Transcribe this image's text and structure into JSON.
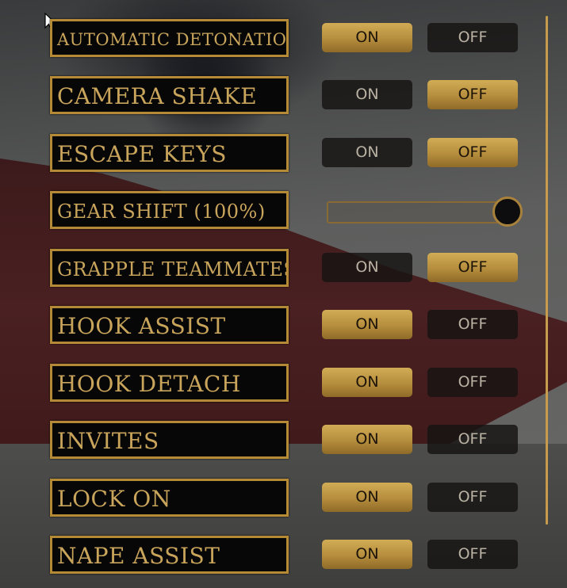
{
  "settings": [
    {
      "label": "AUTOMATIC DETONATION",
      "type": "toggle",
      "on_label": "ON",
      "off_label": "OFF",
      "value": "ON"
    },
    {
      "label": "CAMERA SHAKE",
      "type": "toggle",
      "on_label": "ON",
      "off_label": "OFF",
      "value": "OFF"
    },
    {
      "label": "ESCAPE KEYS",
      "type": "toggle",
      "on_label": "ON",
      "off_label": "OFF",
      "value": "OFF"
    },
    {
      "label": "GEAR SHIFT (100%)",
      "type": "slider",
      "value_percent": 100
    },
    {
      "label": "GRAPPLE TEAMMATES",
      "type": "toggle",
      "on_label": "ON",
      "off_label": "OFF",
      "value": "OFF"
    },
    {
      "label": "HOOK ASSIST",
      "type": "toggle",
      "on_label": "ON",
      "off_label": "OFF",
      "value": "ON"
    },
    {
      "label": "HOOK DETACH",
      "type": "toggle",
      "on_label": "ON",
      "off_label": "OFF",
      "value": "ON"
    },
    {
      "label": "INVITES",
      "type": "toggle",
      "on_label": "ON",
      "off_label": "OFF",
      "value": "ON"
    },
    {
      "label": "LOCK ON",
      "type": "toggle",
      "on_label": "ON",
      "off_label": "OFF",
      "value": "ON"
    },
    {
      "label": "NAPE ASSIST",
      "type": "toggle",
      "on_label": "ON",
      "off_label": "OFF",
      "value": "ON"
    }
  ],
  "colors": {
    "accent_gold": "#c9a55c",
    "label_border": "#b58a37",
    "active_button": "#c29a47",
    "inactive_button": "#161412"
  },
  "icons": {
    "cursor": "arrow-cursor-icon"
  }
}
